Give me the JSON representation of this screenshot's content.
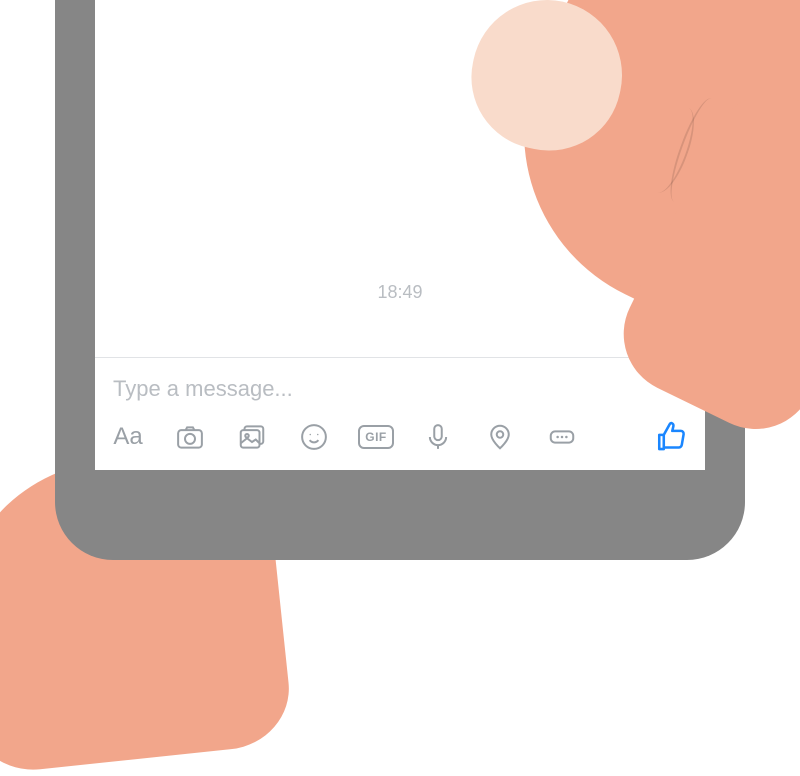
{
  "chat": {
    "timestamp": "18:49"
  },
  "composer": {
    "placeholder": "Type a message..."
  },
  "toolbar": {
    "text_format_label": "Aa",
    "gif_label": "GIF"
  },
  "colors": {
    "accent": "#1a86ff",
    "icon_gray": "#9aa0a6"
  }
}
